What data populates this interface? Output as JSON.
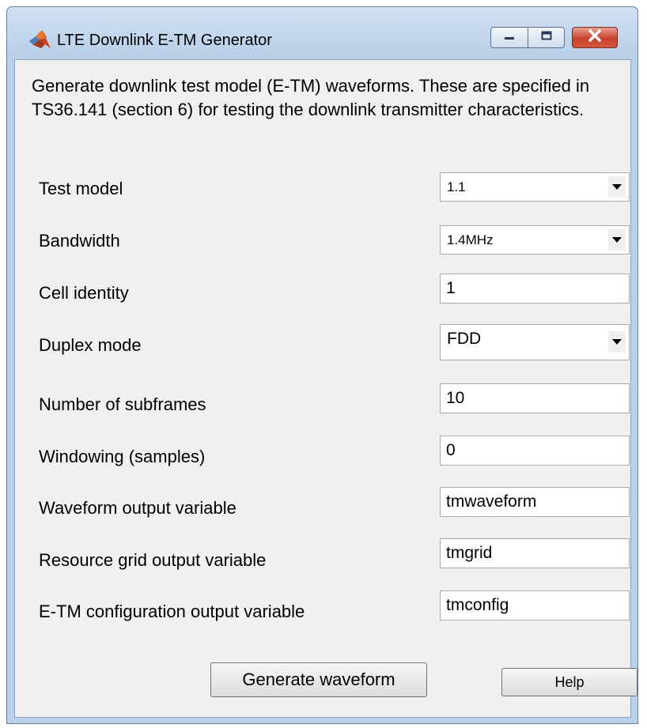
{
  "window": {
    "title": "LTE Downlink E-TM Generator",
    "icon": "matlab-logo-icon",
    "controls": [
      "minimize-icon",
      "maximize-icon",
      "close-icon"
    ]
  },
  "description": "Generate downlink test model (E-TM) waveforms. These are specified in TS36.141 (section 6) for testing the downlink transmitter characteristics.",
  "form": {
    "test_model": {
      "label": "Test model",
      "value": "1.1"
    },
    "bandwidth": {
      "label": "Bandwidth",
      "value": "1.4MHz"
    },
    "cell_identity": {
      "label": "Cell identity",
      "value": "1"
    },
    "duplex_mode": {
      "label": "Duplex mode",
      "value": "FDD"
    },
    "num_subframes": {
      "label": "Number of subframes",
      "value": "10"
    },
    "windowing": {
      "label": "Windowing (samples)",
      "value": "0"
    },
    "waveform_var": {
      "label": "Waveform output variable",
      "value": "tmwaveform"
    },
    "grid_var": {
      "label": "Resource grid output variable",
      "value": "tmgrid"
    },
    "config_var": {
      "label": "E-TM configuration output variable",
      "value": "tmconfig"
    }
  },
  "buttons": {
    "generate": "Generate waveform",
    "help": "Help"
  },
  "colors": {
    "window_frame": "#b9d1ea",
    "client_bg": "#f0f0f0",
    "close_button": "#c9422c"
  }
}
